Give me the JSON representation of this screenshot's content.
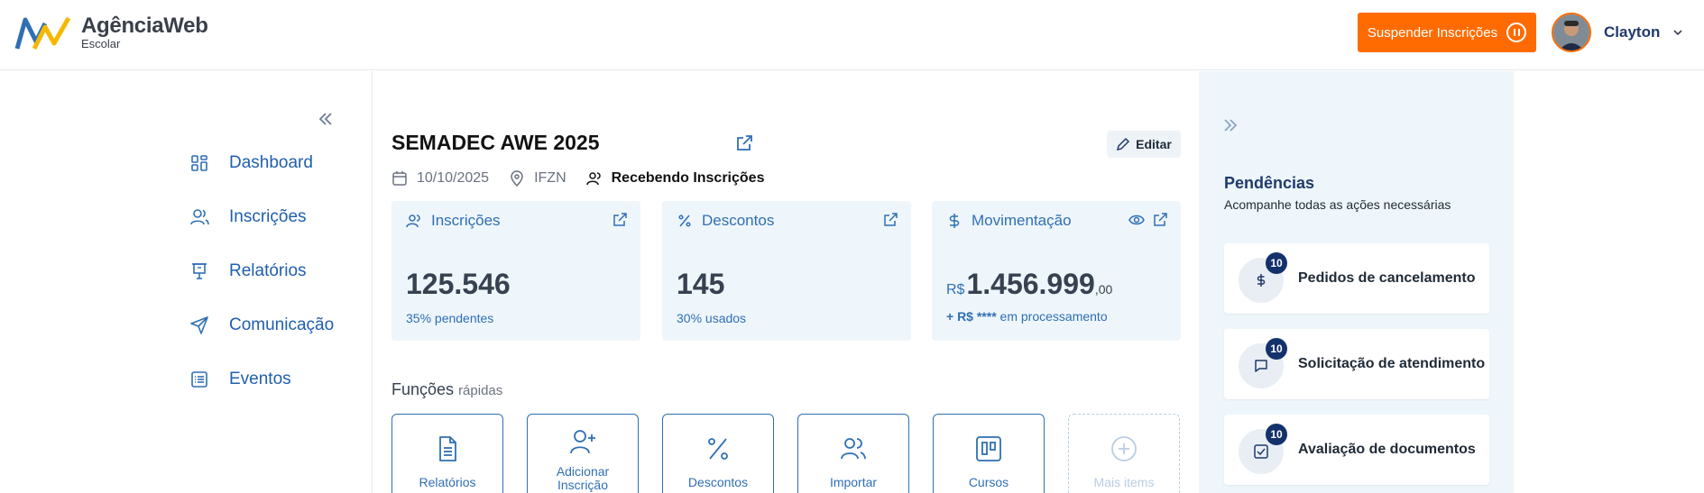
{
  "brand": {
    "name": "AgênciaWeb",
    "sub": "Escolar"
  },
  "header": {
    "suspend_label": "Suspender Inscrições",
    "user_name": "Clayton",
    "accent": "#ff6b00"
  },
  "sidebar": {
    "items": [
      {
        "label": "Dashboard",
        "icon": "grid-icon"
      },
      {
        "label": "Inscrições",
        "icon": "users-icon"
      },
      {
        "label": "Relatórios",
        "icon": "presentation-icon"
      },
      {
        "label": "Comunicação",
        "icon": "send-icon"
      },
      {
        "label": "Eventos",
        "icon": "list-icon"
      }
    ]
  },
  "event": {
    "title": "SEMADEC AWE 2025",
    "edit_label": "Editar",
    "date": "10/10/2025",
    "location": "IFZN",
    "status": "Recebendo Inscrições"
  },
  "stats": {
    "inscricoes": {
      "label": "Inscrições",
      "value": "125.546",
      "sub": "35% pendentes"
    },
    "descontos": {
      "label": "Descontos",
      "value": "145",
      "sub": "30% usados"
    },
    "movimentacao": {
      "label": "Movimentação",
      "currency": "R$",
      "value": "1.456.999",
      "cents": ",00",
      "sub_bold": "+ R$ ****",
      "sub_rest": " em processamento"
    }
  },
  "quick": {
    "title": "Funções",
    "title_small": "rápidas",
    "items": [
      {
        "label": "Relatórios"
      },
      {
        "label": "Adicionar Inscrição"
      },
      {
        "label": "Descontos"
      },
      {
        "label": "Importar"
      },
      {
        "label": "Cursos"
      },
      {
        "label": "Mais items"
      }
    ]
  },
  "pending": {
    "title": "Pendências",
    "subtitle": "Acompanhe todas as ações necessárias",
    "items": [
      {
        "label": "Pedidos de cancelamento",
        "count": "10",
        "icon": "dollar-icon"
      },
      {
        "label": "Solicitação de atendimento",
        "count": "10",
        "icon": "chat-icon"
      },
      {
        "label": "Avaliação de documentos",
        "count": "10",
        "icon": "check-square-icon"
      }
    ]
  }
}
